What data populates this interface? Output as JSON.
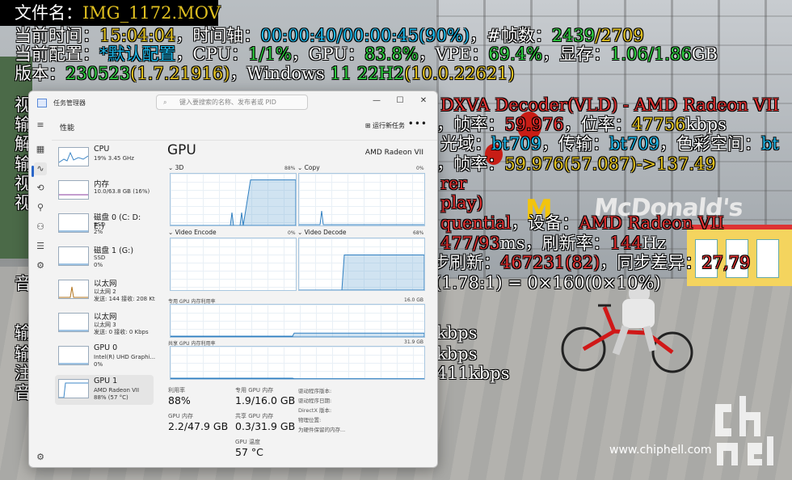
{
  "osd": {
    "file_label": "文件名：",
    "file_name": "IMG_1172.MOV",
    "line1": {
      "k1": "当前时间：",
      "v1": "15:04:04",
      "k2": "，时间轴：",
      "v2": "00:00:40/00:00:45(90%)",
      "k3": "，#帧数：",
      "v3": "2439",
      "v3b": "/2709"
    },
    "line2": {
      "k1": "当前配置：",
      "v1": "*默认配置",
      "k2": "，CPU：",
      "v2": "1/1%",
      "k3": "，GPU：",
      "v3": "83.8%",
      "k4": "，VPE：",
      "v4": "69.4%",
      "k5": "，显存：",
      "v5": "1.06/1.86",
      "u5": "GB"
    },
    "line3": {
      "k1": "版本：",
      "v1": "230523",
      "v2": "(1.7.21916)",
      "k2": "，Windows ",
      "v3": "11 22H2",
      "v4": "(10.0.22621)"
    },
    "left_chars": [
      "视",
      "输",
      "解",
      "输",
      "视",
      "视",
      "音",
      "输",
      "输",
      "注",
      "音"
    ],
    "right_texts": {
      "decoder": "DXVA Decoder(VLD) - AMD Radeon VII",
      "fps_a": ")，帧率：",
      "fps_a_v": "59.976",
      "bitrate_k": "，位率：",
      "bitrate_v": "47756",
      "bitrate_u": "kbps",
      "color_k": "光域：",
      "color_v1": "bt709",
      "color_k2": "，传输：",
      "color_v2": "bt709",
      "color_k3": "，色彩空间：",
      "color_v3": "bt",
      "fps_b": ")，帧率：",
      "fps_b_v": "59.976",
      "fps_b_v2": "(57.087)",
      "fps_b_v3": "->137.49",
      "rer": "rer",
      "play": "play)",
      "seq": "quential",
      "dev_k": "，设备：",
      "dev_v": "AMD Radeon VII",
      "ms_v": "477/93",
      "ms_u": "ms",
      "refresh_k": "，刷新率：",
      "refresh_v": "144",
      "refresh_u": "Hz",
      "sync_k": "步刷新：",
      "sync_v": "467231(82)",
      "sync_k2": "，同步差异：",
      "sync_v2": "27,79",
      "aspect": "(1.78:1) = 0×160(0×10%)",
      "kbps1": "kbps",
      "kbps2": "kbps",
      "kbps3": "411kbps"
    }
  },
  "watermark": "www.chiphell.com",
  "taskmanager": {
    "app_name": "任务管理器",
    "search_placeholder": "键入要搜索的名称、发布者或 PID",
    "header_title": "性能",
    "run_task": "运行新任务",
    "more": "•••",
    "sidebar_icons": [
      "menu-icon",
      "processes-icon",
      "performance-icon",
      "app-history-icon",
      "startup-icon",
      "users-icon",
      "details-icon",
      "services-icon",
      "settings-icon"
    ],
    "items": [
      {
        "t1": "CPU",
        "t2": "19% 3.45 GHz",
        "t3": ""
      },
      {
        "t1": "内存",
        "t2": "10.0/63.8 GB (16%)",
        "t3": ""
      },
      {
        "t1": "磁盘 0 (C: D: E:)",
        "t2": "SSD",
        "t3": "2%"
      },
      {
        "t1": "磁盘 1 (G:)",
        "t2": "SSD",
        "t3": "0%"
      },
      {
        "t1": "以太网",
        "t2": "以太网 2",
        "t3": "发送: 144 接收: 208 Kt"
      },
      {
        "t1": "以太网",
        "t2": "以太网 3",
        "t3": "发送: 0 接收: 0 Kbps"
      },
      {
        "t1": "GPU 0",
        "t2": "Intel(R) UHD Graphi...",
        "t3": "0%"
      },
      {
        "t1": "GPU 1",
        "t2": "AMD Radeon VII",
        "t3": "88% (57 °C)"
      }
    ],
    "gpu": {
      "title": "GPU",
      "name": "AMD Radeon VII",
      "engines": [
        {
          "label": "3D",
          "pct": "88%"
        },
        {
          "label": "Copy",
          "pct": "0%"
        },
        {
          "label": "Video Encode",
          "pct": "0%"
        },
        {
          "label": "Video Decode",
          "pct": "68%"
        }
      ],
      "dedicated_label": "专用 GPU 内存利用率",
      "dedicated_max": "16.0 GB",
      "shared_label": "共享 GPU 内存利用率",
      "shared_max": "31.9 GB",
      "stats": {
        "util_k": "利用率",
        "util_v": "88%",
        "ded_k": "专用 GPU 内存",
        "ded_v": "1.9/16.0 GB",
        "mem_k": "GPU 内存",
        "mem_v": "2.2/47.9 GB",
        "shr_k": "共享 GPU 内存",
        "shr_v": "0.3/31.9 GB",
        "temp_k": "GPU 温度",
        "temp_v": "57 °C"
      },
      "props": [
        "驱动程序版本:",
        "驱动程序日期:",
        "DirectX 版本:",
        "物理位置:",
        "为硬件保留的内存..."
      ]
    },
    "levels": {
      "d3": 0.88,
      "video_decode": 0.68,
      "dedicated_mem": 0.12,
      "shared_mem": 0.01
    }
  }
}
